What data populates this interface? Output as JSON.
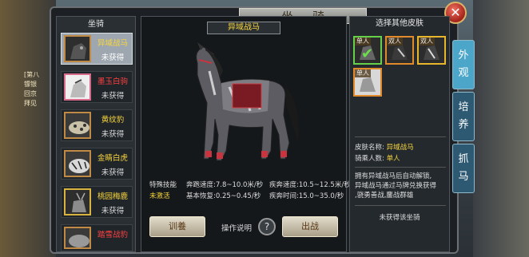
{
  "title": "坐骑",
  "left_panel": {
    "header": "坐骑",
    "mounts": [
      {
        "name": "异域战马",
        "status": "未获得",
        "name_color": "yellow",
        "selected": true
      },
      {
        "name": "墨玉白驹",
        "status": "未获得",
        "name_color": "red"
      },
      {
        "name": "黄纹豹",
        "status": "未获得",
        "name_color": "yellow"
      },
      {
        "name": "金睛白虎",
        "status": "未获得",
        "name_color": "yellow"
      },
      {
        "name": "桃园梅鹿",
        "status": "未获得",
        "name_color": "yellow"
      },
      {
        "name": "踏雪战豹",
        "status": "",
        "name_color": "red"
      }
    ]
  },
  "center": {
    "horse_name": "异域战马",
    "stats": {
      "special_skill_label": "特殊技能",
      "special_skill_value": "未激活",
      "run_speed": "奔跑速度:7.8~10.0米/秒",
      "sprint_speed": "疾奔速度:10.5~12.5米/秒",
      "base_recovery": "基本恢复:0.25~0.45/秒",
      "sprint_time": "疾奔时间:15.0~35.0/秒"
    },
    "btn_left": "训養",
    "op_help": "操作说明",
    "btn_right": "出战"
  },
  "right_panel": {
    "header": "选择其他皮肤",
    "skins": [
      {
        "tag": "单人",
        "selected": true
      },
      {
        "tag": "双人"
      },
      {
        "tag": "双人"
      },
      {
        "tag": "单人"
      }
    ],
    "skin_name_label": "皮肤名称:",
    "skin_name_value": "异域战马",
    "rider_count_label": "骑乘人数:",
    "rider_count_value": "单人",
    "desc_line1": "拥有异域战马后自动解锁,",
    "desc_line2": "异域战马通过马牌兑换获得",
    "desc_line3": ",骁勇善战,鏖战群雄",
    "status_text": "未获得该坐骑"
  },
  "side_tabs": [
    "外观",
    "培养",
    "抓马"
  ],
  "bg_text": [
    "[第八",
    "镖银",
    "回京",
    "拜见"
  ],
  "colors": {
    "accent_yellow": "#f7d53c",
    "red": "#ff4040",
    "green": "#66d04a",
    "tab_active": "#4ba6c9"
  }
}
